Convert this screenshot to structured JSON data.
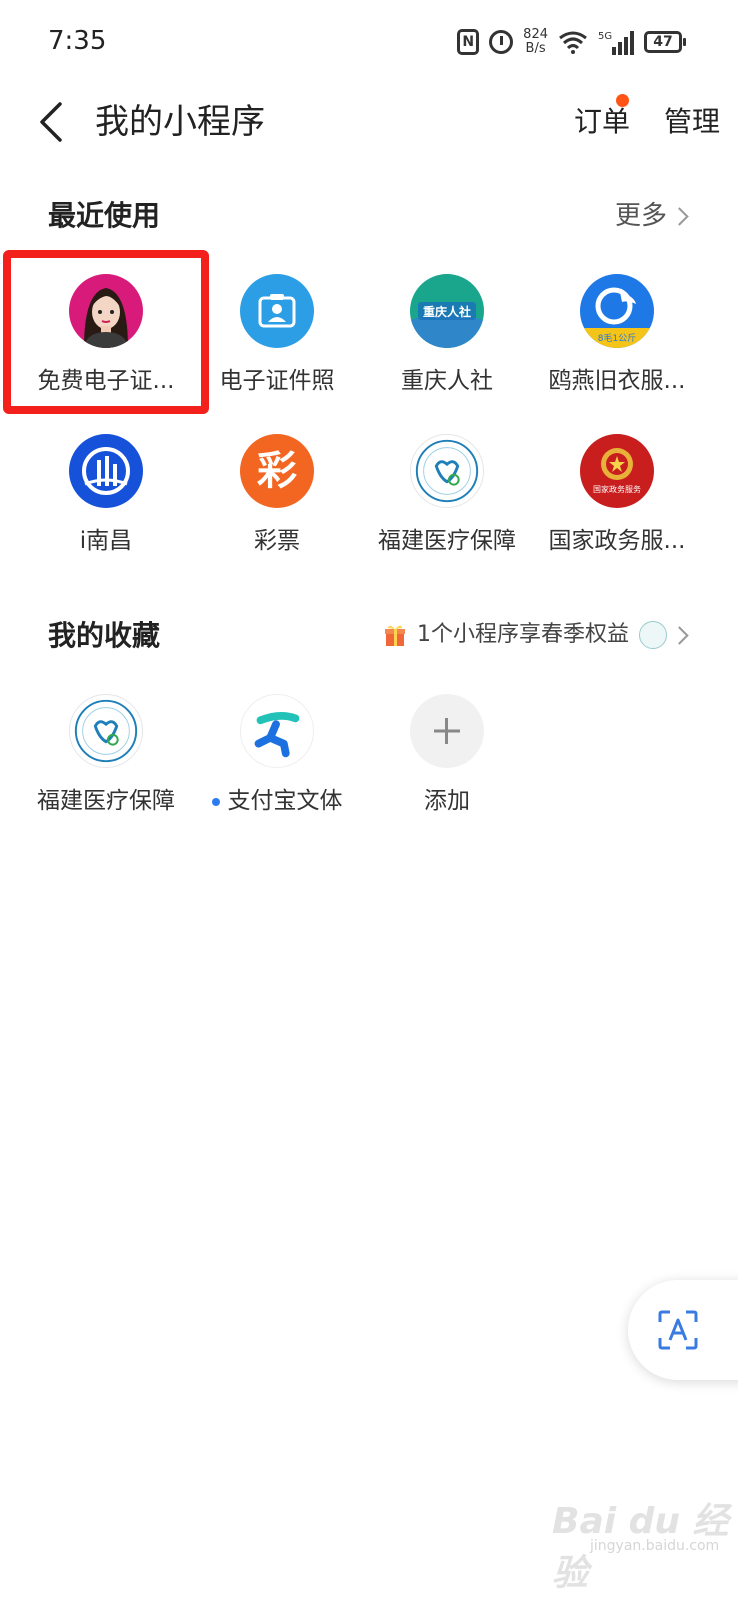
{
  "status_bar": {
    "time": "7:35",
    "nfc": "N",
    "net_speed_value": "824",
    "net_speed_unit": "B/s",
    "network": "5G",
    "battery": "47"
  },
  "header": {
    "title": "我的小程序",
    "orders_label": "订单",
    "manage_label": "管理",
    "orders_has_notification": true
  },
  "recent": {
    "title": "最近使用",
    "more_label": "更多",
    "apps": [
      {
        "label": "免费电子证...",
        "icon": "avatar-woman-icon",
        "highlighted": true
      },
      {
        "label": "电子证件照",
        "icon": "id-photo-icon"
      },
      {
        "label": "重庆人社",
        "icon": "chongqing-hrss-icon",
        "icon_text": "重庆人社"
      },
      {
        "label": "鸥燕旧衣服...",
        "icon": "bird-logo-icon",
        "icon_text": "8毛1公斤"
      },
      {
        "label": "i南昌",
        "icon": "bridge-logo-icon"
      },
      {
        "label": "彩票",
        "icon": "lottery-icon",
        "icon_text": "彩"
      },
      {
        "label": "福建医疗保障",
        "icon": "fujian-medical-icon"
      },
      {
        "label": "国家政务服...",
        "icon": "national-emblem-icon",
        "icon_text": "国家政务服务"
      }
    ]
  },
  "favorites": {
    "title": "我的收藏",
    "promo_text": "1个小程序享春季权益",
    "apps": [
      {
        "label": "福建医疗保障",
        "icon": "fujian-medical-icon"
      },
      {
        "label": "支付宝文体",
        "icon": "running-person-icon",
        "has_dot": true
      },
      {
        "label": "添加",
        "icon": "plus-icon"
      }
    ]
  },
  "colors": {
    "highlight": "#f3201c",
    "notification_dot": "#ff5416",
    "blue_dot": "#2b7cf1"
  },
  "watermark": {
    "text": "Bai du 经验",
    "sub": "jingyan.baidu.com"
  }
}
